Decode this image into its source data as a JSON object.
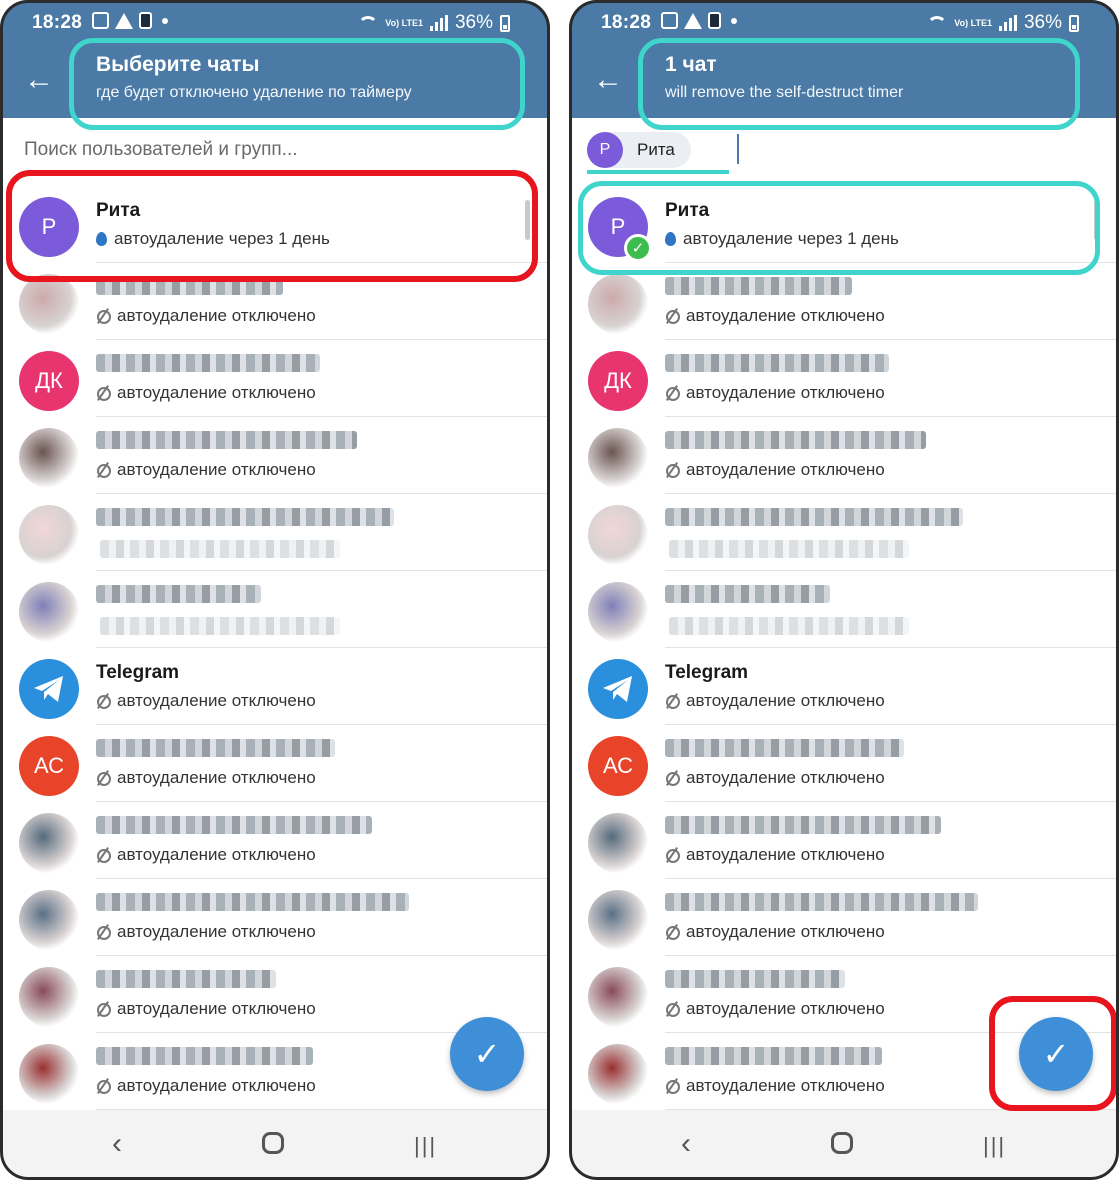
{
  "left": {
    "status_time": "18:28",
    "battery": "36%",
    "lte": "Vo) LTE1",
    "title": "Выберите чаты",
    "subtitle": "где будет отключено удаление по таймеру",
    "search_placeholder": "Поиск пользователей и групп...",
    "chats": [
      {
        "name": "Рита",
        "initials": "Р",
        "avatar_color": "#7b5bd9",
        "status": "автоудаление через 1 день",
        "status_type": "timer"
      },
      {
        "name": "",
        "initials": "",
        "avatar_color": "#caa",
        "status": "автоудаление отключено",
        "status_type": "off",
        "blurred": true
      },
      {
        "name": "",
        "initials": "ДК",
        "avatar_color": "#e8346f",
        "status": "автоудаление отключено",
        "status_type": "off",
        "blurred": true
      },
      {
        "name": "",
        "initials": "",
        "avatar_color": "#6a5450",
        "status": "автоудаление отключено",
        "status_type": "off",
        "blurred": true
      },
      {
        "name": "",
        "initials": "",
        "avatar_color": "#f2d6d6",
        "status": "",
        "status_type": "hidden",
        "blurred": true
      },
      {
        "name": "",
        "initials": "",
        "avatar_color": "#7f7fb8",
        "status": "",
        "status_type": "hidden",
        "blurred": true
      },
      {
        "name": "Telegram",
        "initials": "",
        "avatar_color": "#2a8fdc",
        "status": "автоудаление отключено",
        "status_type": "off",
        "icon": "telegram-icon"
      },
      {
        "name": "",
        "initials": "АС",
        "avatar_color": "#e8442a",
        "status": "автоудаление отключено",
        "status_type": "off",
        "blurred": true
      },
      {
        "name": "",
        "initials": "",
        "avatar_color": "#556a7c",
        "status": "автоудаление отключено",
        "status_type": "off",
        "blurred": true
      },
      {
        "name": "",
        "initials": "",
        "avatar_color": "#5a6f86",
        "status": "автоудаление отключено",
        "status_type": "off",
        "blurred": true
      },
      {
        "name": "",
        "initials": "",
        "avatar_color": "#8a4a5a",
        "status": "автоудаление отключено",
        "status_type": "off",
        "blurred": true
      },
      {
        "name": "",
        "initials": "",
        "avatar_color": "#9a3030",
        "status": "автоудаление отключено",
        "status_type": "off",
        "blurred": true
      }
    ],
    "fab_icon": "check-icon"
  },
  "right": {
    "status_time": "18:28",
    "battery": "36%",
    "lte": "Vo) LTE1",
    "title": "1 чат",
    "subtitle": "will remove the self-destruct timer",
    "selected_chip": {
      "initials": "Р",
      "name": "Рита"
    },
    "chats": [
      {
        "name": "Рита",
        "initials": "Р",
        "avatar_color": "#7b5bd9",
        "status": "автоудаление через 1 день",
        "status_type": "timer",
        "selected": true
      },
      {
        "name": "",
        "initials": "",
        "avatar_color": "#caa",
        "status": "автоудаление отключено",
        "status_type": "off",
        "blurred": true
      },
      {
        "name": "",
        "initials": "ДК",
        "avatar_color": "#e8346f",
        "status": "автоудаление отключено",
        "status_type": "off",
        "blurred": true
      },
      {
        "name": "",
        "initials": "",
        "avatar_color": "#6a5450",
        "status": "автоудаление отключено",
        "status_type": "off",
        "blurred": true
      },
      {
        "name": "",
        "initials": "",
        "avatar_color": "#f2d6d6",
        "status": "",
        "status_type": "hidden",
        "blurred": true
      },
      {
        "name": "",
        "initials": "",
        "avatar_color": "#7f7fb8",
        "status": "",
        "status_type": "hidden",
        "blurred": true
      },
      {
        "name": "Telegram",
        "initials": "",
        "avatar_color": "#2a8fdc",
        "status": "автоудаление отключено",
        "status_type": "off",
        "icon": "telegram-icon"
      },
      {
        "name": "",
        "initials": "АС",
        "avatar_color": "#e8442a",
        "status": "автоудаление отключено",
        "status_type": "off",
        "blurred": true
      },
      {
        "name": "",
        "initials": "",
        "avatar_color": "#556a7c",
        "status": "автоудаление отключено",
        "status_type": "off",
        "blurred": true
      },
      {
        "name": "",
        "initials": "",
        "avatar_color": "#5a6f86",
        "status": "автоудаление отключено",
        "status_type": "off",
        "blurred": true
      },
      {
        "name": "",
        "initials": "",
        "avatar_color": "#8a4a5a",
        "status": "автоудаление отключено",
        "status_type": "off",
        "blurred": true
      },
      {
        "name": "",
        "initials": "",
        "avatar_color": "#9a3030",
        "status": "автоудаление отключено",
        "status_type": "off",
        "blurred": true
      }
    ],
    "fab_icon": "check-icon"
  },
  "colors": {
    "appbar": "#4a7aa5",
    "highlight_teal": "#3fd4cc",
    "highlight_red": "#e8141e",
    "fab": "#3f8fd8",
    "check_badge": "#3ebd4f"
  }
}
